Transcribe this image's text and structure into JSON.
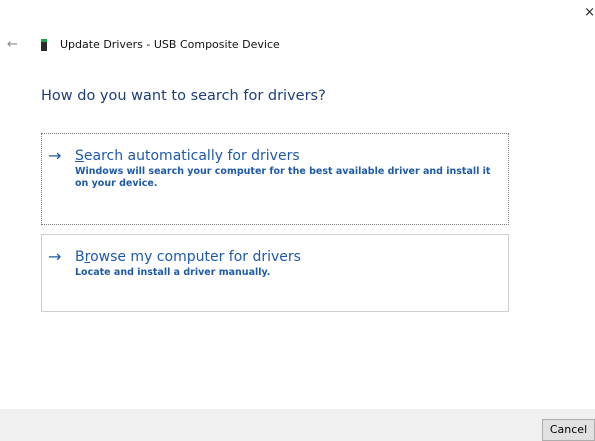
{
  "window": {
    "close_glyph": "×",
    "back_glyph": "←"
  },
  "header": {
    "title": "Update Drivers - USB Composite Device",
    "device_icon": "usb-device-icon"
  },
  "main": {
    "heading": "How do you want to search for drivers?",
    "options": [
      {
        "arrow": "→",
        "title_access": "S",
        "title_rest": "earch automatically for drivers",
        "description": "Windows will search your computer for the best available driver and install it on your device."
      },
      {
        "arrow": "→",
        "title_pre": "B",
        "title_access": "r",
        "title_rest": "owse my computer for drivers",
        "description": "Locate and install a driver manually."
      }
    ]
  },
  "footer": {
    "cancel_label": "Cancel"
  },
  "colors": {
    "accent": "#1f5aa8",
    "heading": "#1c3e7a",
    "footer_bg": "#f0f0f0"
  }
}
